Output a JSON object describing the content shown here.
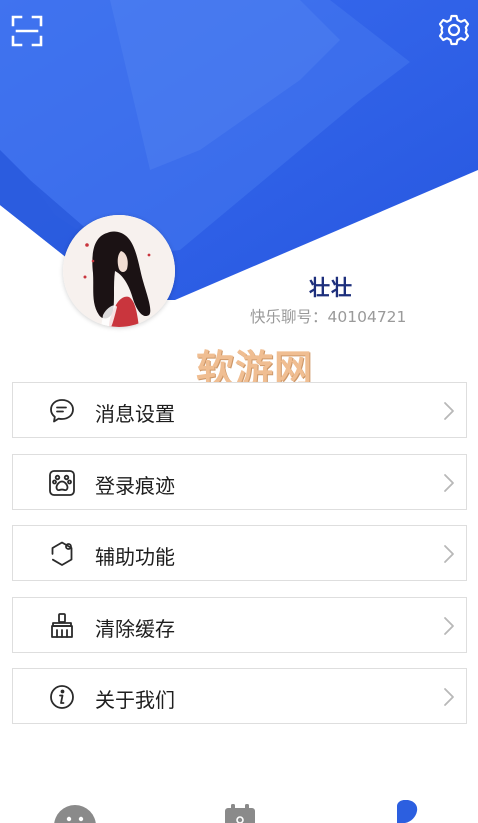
{
  "profile": {
    "name": "壮壮",
    "account_label": "快乐聊号：",
    "account_id": "40104721"
  },
  "watermark": "软游网",
  "menu": [
    {
      "label": "消息设置",
      "icon": "message-icon"
    },
    {
      "label": "登录痕迹",
      "icon": "paw-icon"
    },
    {
      "label": "辅助功能",
      "icon": "hexagon-icon"
    },
    {
      "label": "清除缓存",
      "icon": "broom-icon"
    },
    {
      "label": "关于我们",
      "icon": "info-icon"
    }
  ],
  "colors": {
    "header_primary": "#2f62e4",
    "header_light": "#4a7cf0",
    "name_text": "#1d2f7c",
    "secondary_text": "#9a9a9a",
    "tab_active": "#2c5fe0",
    "tab_inactive": "#8a8a8a"
  },
  "icons": {
    "top_left": "scan-icon",
    "top_right": "gear-icon",
    "arrow": "chevron-right-icon",
    "tabs": [
      "chat-tab-icon",
      "calendar-tab-icon",
      "profile-tab-icon"
    ]
  }
}
